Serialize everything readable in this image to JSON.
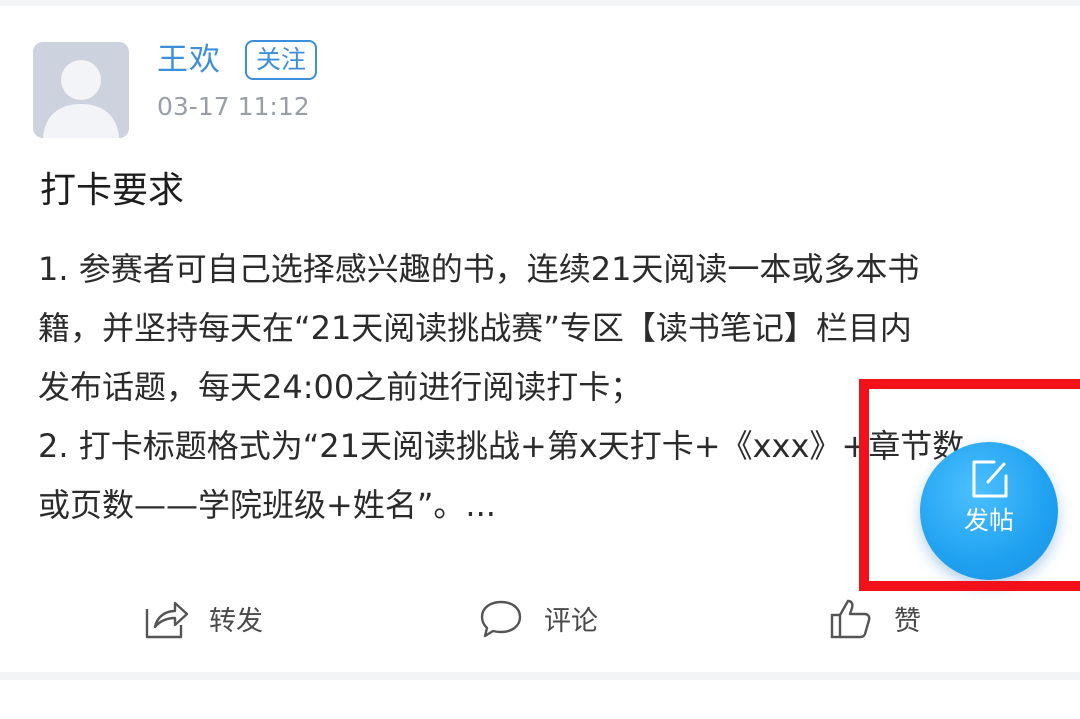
{
  "post": {
    "author": "王欢",
    "follow_label": "关注",
    "timestamp": "03-17 11:12",
    "title": "打卡要求",
    "body_lines": [
      "1. 参赛者可自己选择感兴趣的书，连续21天阅读一本或多本书",
      "籍，并坚持每天在“21天阅读挑战赛”专区【读书笔记】栏目内",
      "发布话题，每天24:00之前进行阅读打卡；",
      "2. 打卡标题格式为“21天阅读挑战+第x天打卡+《xxx》+章节数",
      "或页数——学院班级+姓名”。..."
    ]
  },
  "actions": {
    "forward_label": "转发",
    "comment_label": "评论",
    "like_label": "赞"
  },
  "fab": {
    "label": "发帖",
    "color": "#1fa1f0"
  },
  "colors": {
    "accent": "#3d8fd9",
    "highlight": "#f2111b"
  },
  "icons": {
    "avatar": "user-placeholder-icon",
    "forward": "share-icon",
    "comment": "comment-bubble-icon",
    "like": "thumbs-up-icon",
    "fab": "edit-square-icon"
  }
}
